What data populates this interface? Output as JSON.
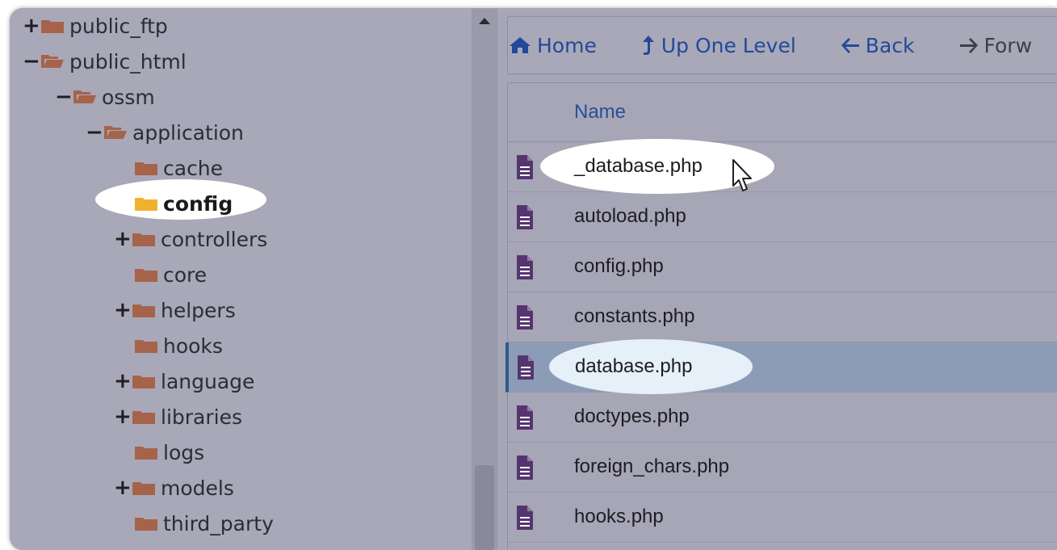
{
  "colors": {
    "folder": "#a5644a",
    "folder_active": "#f0b22e",
    "file_icon": "#55356f",
    "link": "#23499a",
    "selected_row": "#8d9cb6"
  },
  "tree": [
    {
      "toggle": "+",
      "label": "public_ftp",
      "icon": "folder-closed-icon"
    },
    {
      "toggle": "−",
      "label": "public_html",
      "icon": "folder-open-icon"
    },
    {
      "toggle": "−",
      "label": "ossm",
      "icon": "folder-open-icon"
    },
    {
      "toggle": "−",
      "label": "application",
      "icon": "folder-open-icon"
    },
    {
      "toggle": "",
      "label": "cache",
      "icon": "folder-closed-icon"
    },
    {
      "toggle": "",
      "label": "config",
      "icon": "folder-closed-icon",
      "active": true
    },
    {
      "toggle": "+",
      "label": "controllers",
      "icon": "folder-closed-icon"
    },
    {
      "toggle": "",
      "label": "core",
      "icon": "folder-closed-icon"
    },
    {
      "toggle": "+",
      "label": "helpers",
      "icon": "folder-closed-icon"
    },
    {
      "toggle": "",
      "label": "hooks",
      "icon": "folder-closed-icon"
    },
    {
      "toggle": "+",
      "label": "language",
      "icon": "folder-closed-icon"
    },
    {
      "toggle": "+",
      "label": "libraries",
      "icon": "folder-closed-icon"
    },
    {
      "toggle": "",
      "label": "logs",
      "icon": "folder-closed-icon"
    },
    {
      "toggle": "+",
      "label": "models",
      "icon": "folder-closed-icon"
    },
    {
      "toggle": "",
      "label": "third_party",
      "icon": "folder-closed-icon"
    }
  ],
  "toolbar": {
    "home": "Home",
    "up": "Up One Level",
    "back": "Back",
    "forward": "Forw"
  },
  "files": {
    "header": "Name",
    "rows": [
      {
        "name": "_database.php"
      },
      {
        "name": "autoload.php"
      },
      {
        "name": "config.php"
      },
      {
        "name": "constants.php"
      },
      {
        "name": "database.php",
        "selected": true
      },
      {
        "name": "doctypes.php"
      },
      {
        "name": "foreign_chars.php"
      },
      {
        "name": "hooks.php"
      }
    ]
  }
}
